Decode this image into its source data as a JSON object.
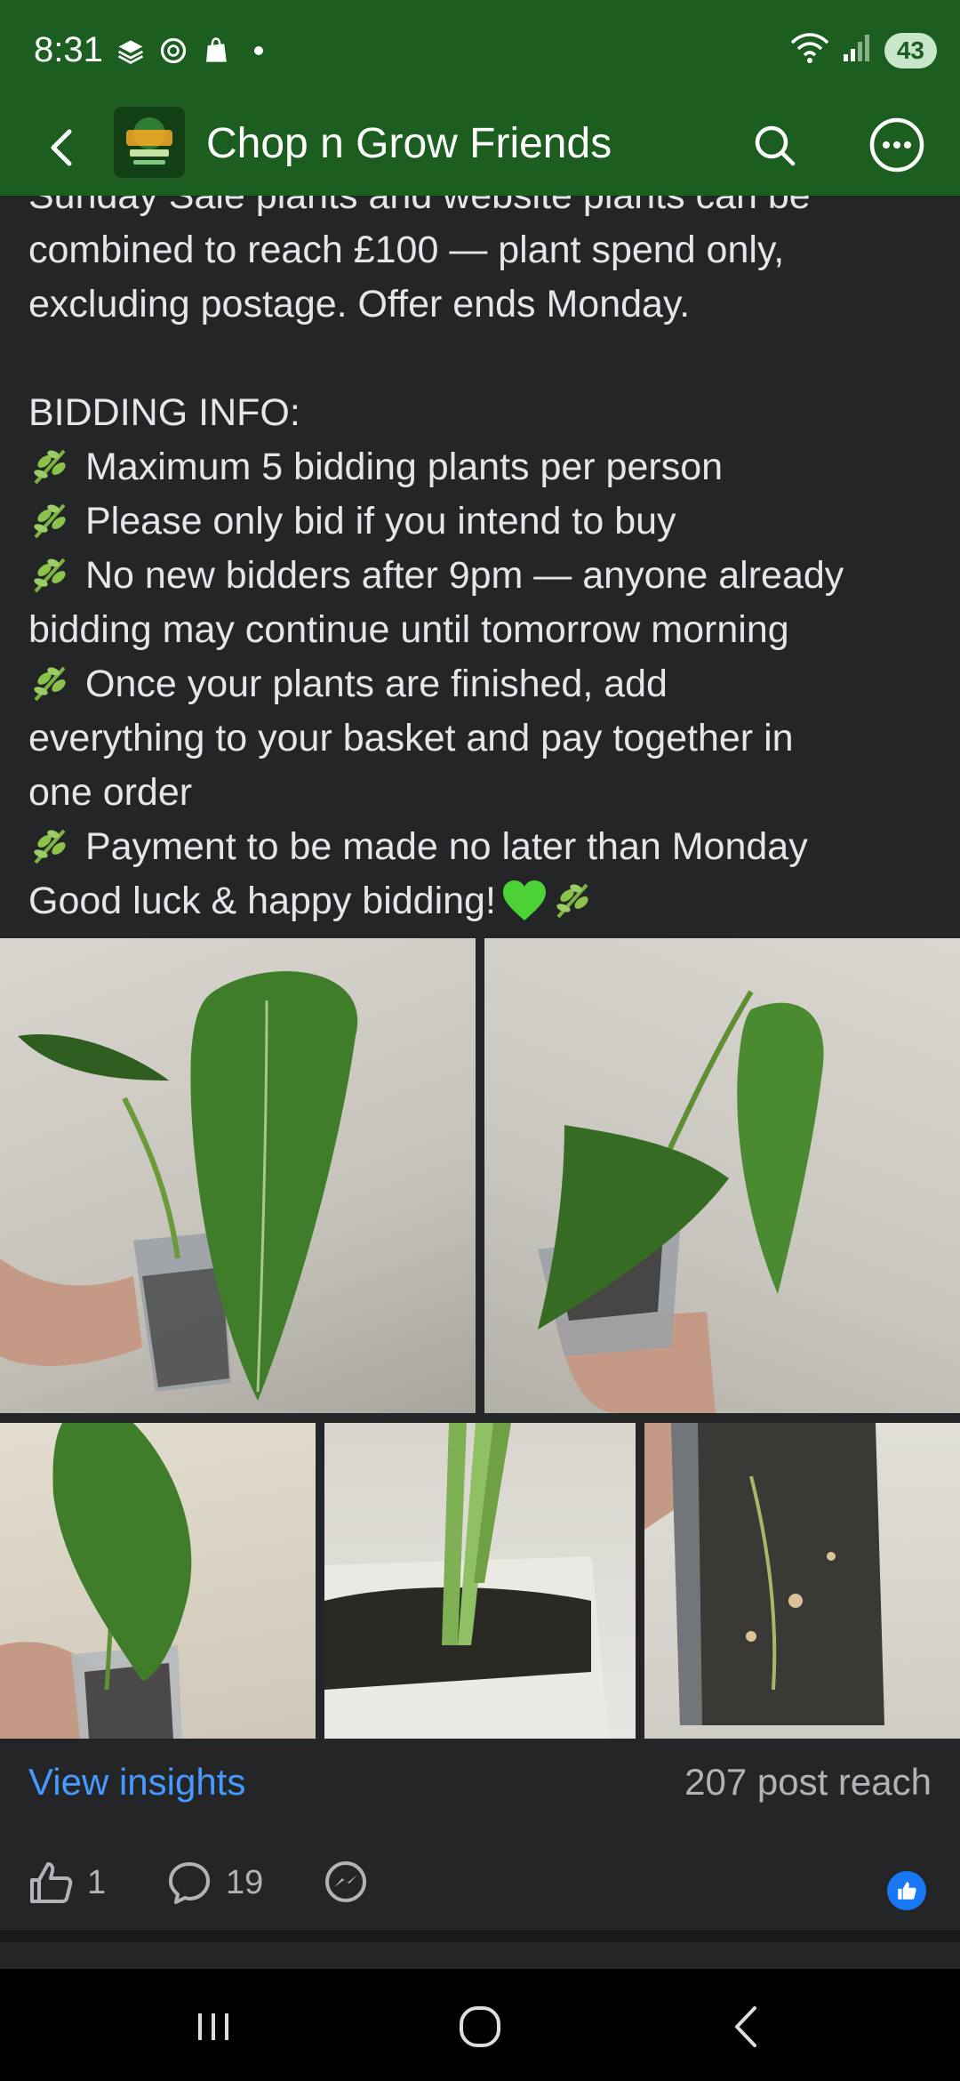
{
  "status_bar": {
    "time": "8:31",
    "battery": "43"
  },
  "app_bar": {
    "title": "Chop n Grow Friends"
  },
  "post": {
    "lines": [
      "Sunday Sale plants and website plants can be",
      "combined to reach £100 — plant spend only,",
      "excluding postage. Offer ends Monday.",
      "BIDDING INFO:",
      "Maximum 5 bidding plants per person",
      "Please only bid if you intend to buy",
      "No new bidders after 9pm — anyone already",
      "bidding may continue until tomorrow morning",
      "Once your plants are finished, add",
      "everything to your basket and pay together in",
      "one order",
      "Payment to be made no later than Monday",
      "Good luck & happy bidding!"
    ]
  },
  "insights": {
    "link": "View insights",
    "reach": "207 post reach"
  },
  "actions": {
    "likes": "1",
    "comments": "19"
  },
  "colors": {
    "header_green": "#1b5e20",
    "link_blue": "#4599ff",
    "bg_dark": "#242527"
  }
}
